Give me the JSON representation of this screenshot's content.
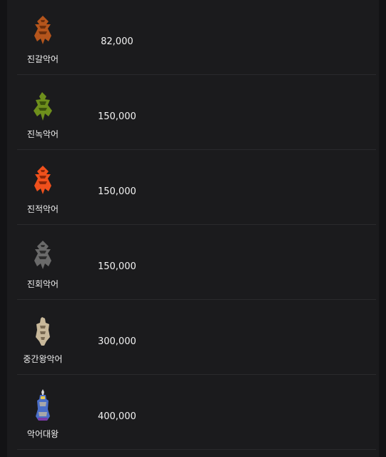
{
  "rows": [
    {
      "name": "진갈악어",
      "value": "82,000",
      "icon": "brown-crocodile-icon",
      "color": "#b5551c",
      "shade": "#6e2f0c"
    },
    {
      "name": "진녹악어",
      "value": "150,000",
      "icon": "green-crocodile-icon",
      "color": "#6e8f1c",
      "shade": "#3b520c"
    },
    {
      "name": "진적악어",
      "value": "150,000",
      "icon": "red-crocodile-icon",
      "color": "#f0501c",
      "shade": "#8e2608"
    },
    {
      "name": "진회악어",
      "value": "150,000",
      "icon": "gray-crocodile-icon",
      "color": "#6a6a6a",
      "shade": "#2e2e2e"
    },
    {
      "name": "중간왕악어",
      "value": "300,000",
      "icon": "bone-crocodile-icon",
      "color": "#c8b89a",
      "shade": "#7a6a52"
    },
    {
      "name": "악어대왕",
      "value": "400,000",
      "icon": "crocodile-king-icon",
      "color": "#4a6ec8",
      "shade": "#a8a8a8"
    }
  ]
}
